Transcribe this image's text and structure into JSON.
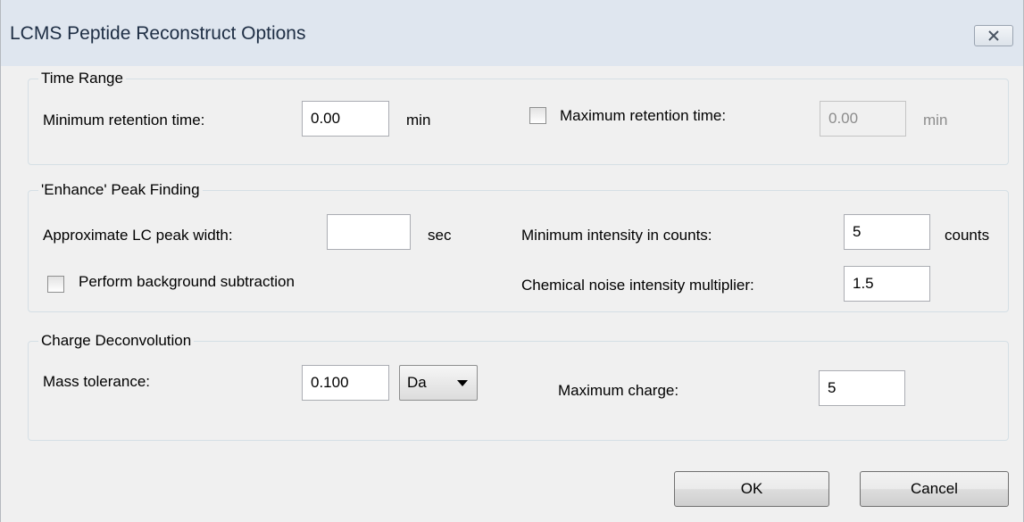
{
  "window": {
    "title": "LCMS Peptide Reconstruct Options"
  },
  "time_range": {
    "group_label": "Time Range",
    "min_rt_label": "Minimum retention time:",
    "min_rt_value": "0.00",
    "min_rt_unit": "min",
    "max_rt_checked": false,
    "max_rt_label": "Maximum retention time:",
    "max_rt_value": "0.00",
    "max_rt_unit": "min",
    "max_rt_enabled": false
  },
  "enhance": {
    "group_label": "'Enhance' Peak Finding",
    "peak_width_label": "Approximate LC peak width:",
    "peak_width_value": "",
    "peak_width_unit": "sec",
    "bg_sub_checked": false,
    "bg_sub_label": "Perform background subtraction",
    "min_intensity_label": "Minimum intensity in counts:",
    "min_intensity_value": "5",
    "min_intensity_unit": "counts",
    "noise_mult_label": "Chemical noise intensity multiplier:",
    "noise_mult_value": "1.5"
  },
  "charge": {
    "group_label": "Charge Deconvolution",
    "mass_tol_label": "Mass tolerance:",
    "mass_tol_value": "0.100",
    "mass_tol_unit_selected": "Da",
    "max_charge_label": "Maximum charge:",
    "max_charge_value": "5"
  },
  "buttons": {
    "ok": "OK",
    "cancel": "Cancel"
  },
  "icons": {
    "close": "close-icon",
    "dropdown": "chevron-down-icon"
  }
}
